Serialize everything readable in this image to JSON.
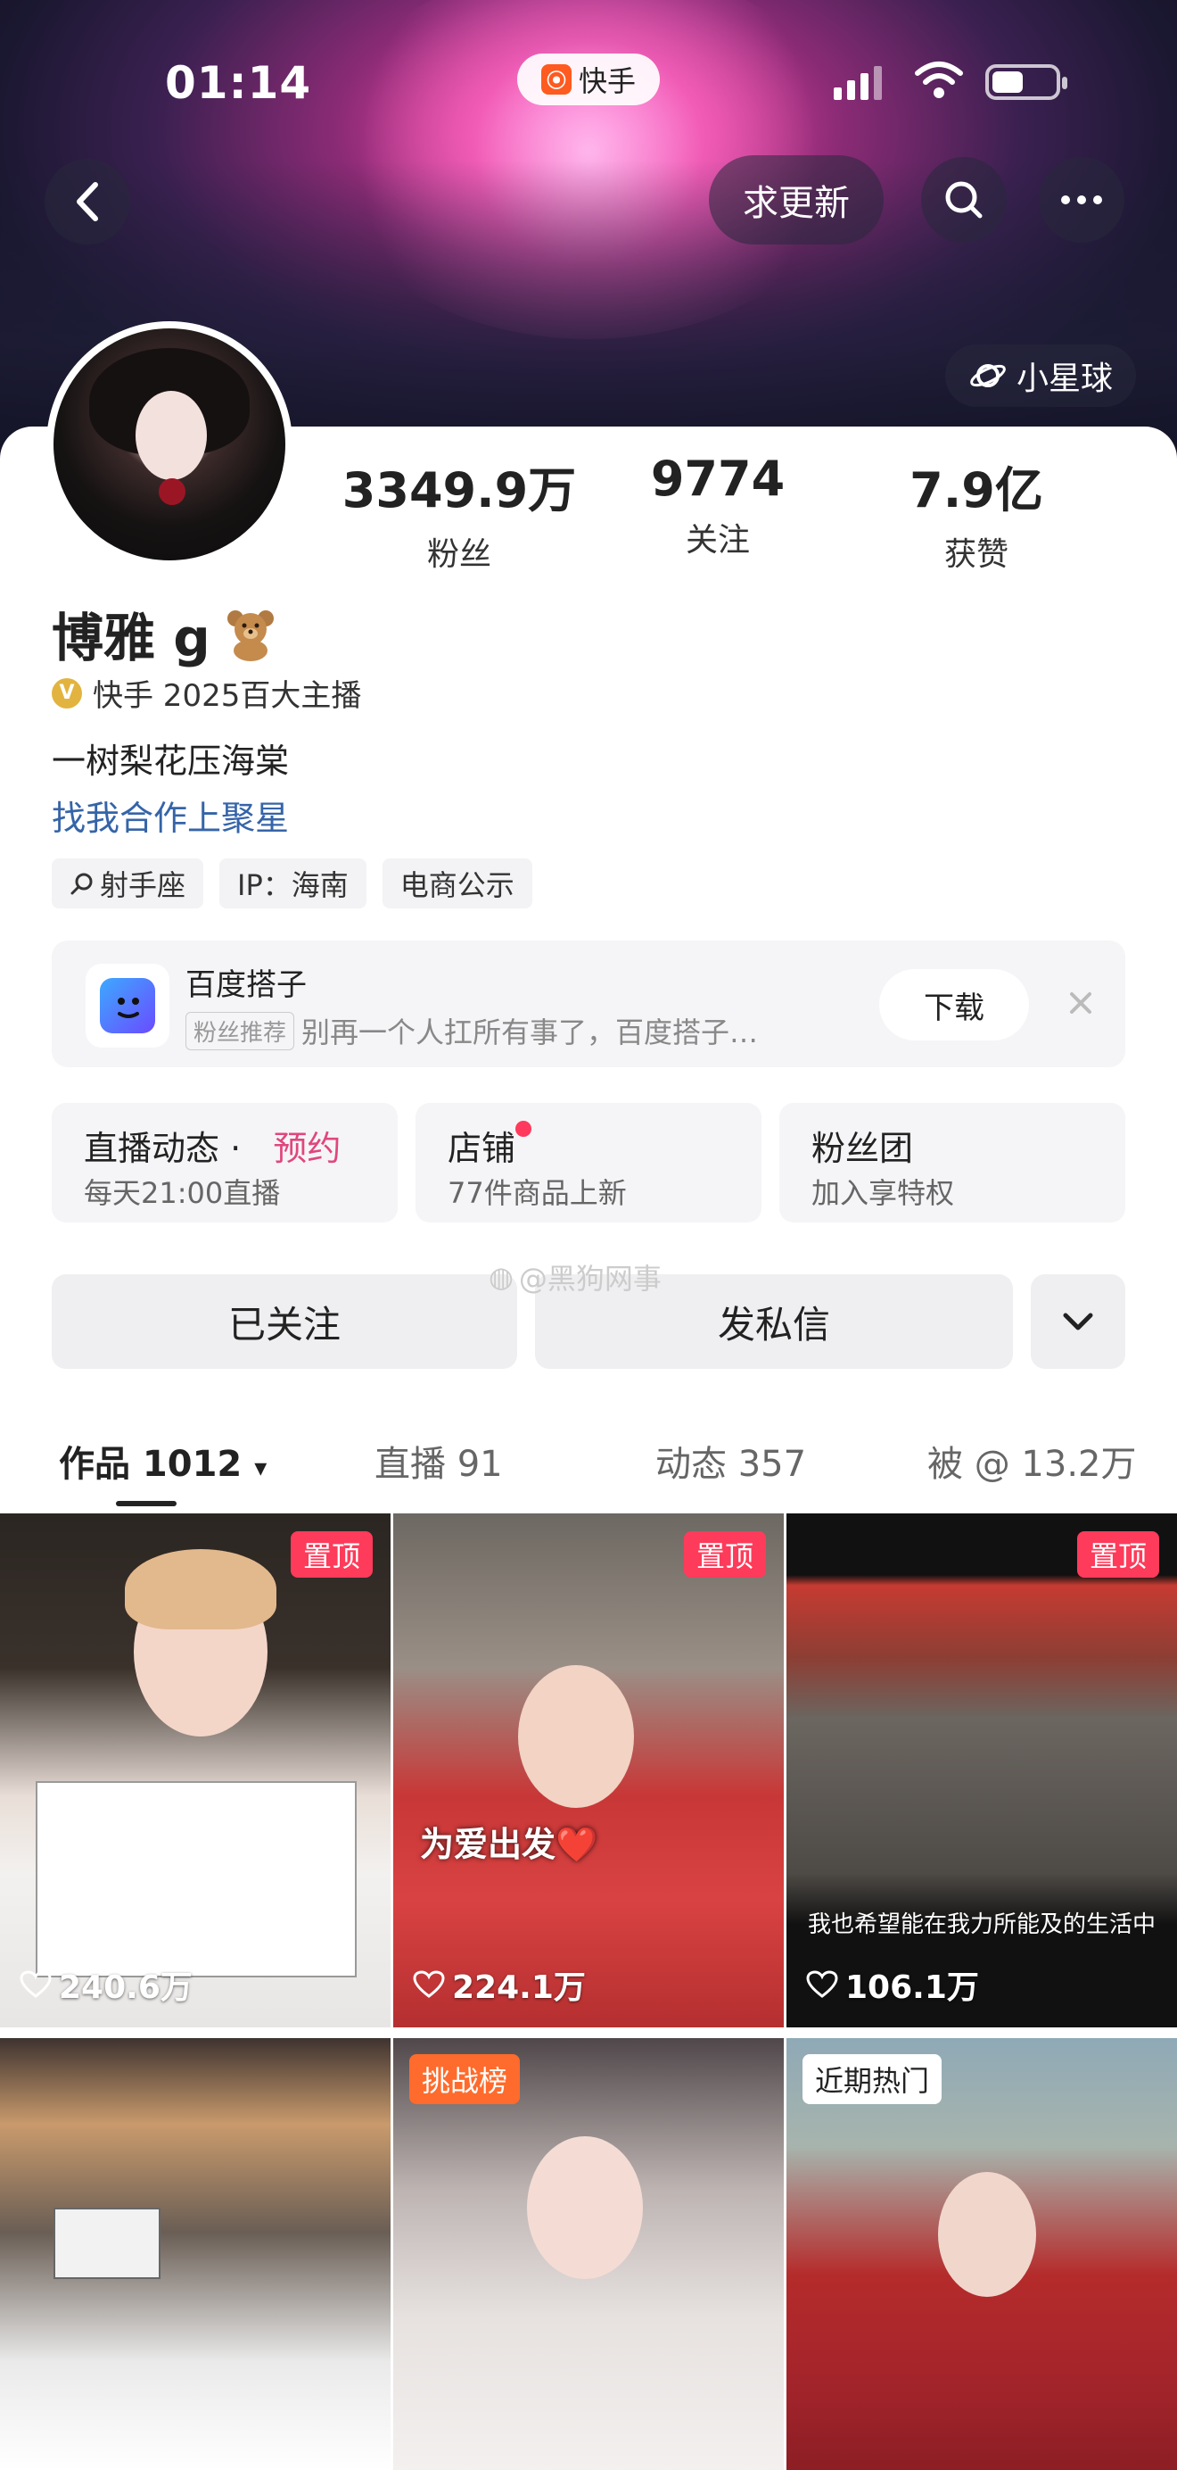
{
  "status_bar": {
    "time": "01:14",
    "app_name": "快手"
  },
  "nav": {
    "update_label": "求更新",
    "planet_label": "小星球"
  },
  "profile": {
    "name": "博雅 g",
    "badge_text": "快手 2025百大主播",
    "bio": "一树梨花压海棠",
    "link_text": "找我合作上聚星",
    "tags": [
      "射手座",
      "IP：海南",
      "电商公示"
    ]
  },
  "stats": [
    {
      "value": "3349.9万",
      "label": "粉丝"
    },
    {
      "value": "9774",
      "label": "关注"
    },
    {
      "value": "7.9亿",
      "label": "获赞"
    }
  ],
  "ad": {
    "title": "百度搭子",
    "tag": "粉丝推荐",
    "desc": "别再一个人扛所有事了，百度搭子…",
    "download_label": "下载"
  },
  "features": [
    {
      "title": "直播动态 ·",
      "highlight": "预约",
      "sub": "每天21:00直播"
    },
    {
      "title": "店铺",
      "sub": "77件商品上新"
    },
    {
      "title": "粉丝团",
      "sub": "加入享特权"
    }
  ],
  "watermark": "@黑狗网事",
  "actions": {
    "follow_label": "已关注",
    "message_label": "发私信"
  },
  "tabs": [
    {
      "label": "作品 1012"
    },
    {
      "label": "直播 91"
    },
    {
      "label": "动态 357"
    },
    {
      "label": "被 @ 13.2万"
    }
  ],
  "videos": [
    {
      "badge": "置顶",
      "likes": "240.6万"
    },
    {
      "badge": "置顶",
      "likes": "224.1万",
      "overlay": "为爱出发❤️"
    },
    {
      "badge": "置顶",
      "likes": "106.1万",
      "caption": "我也希望能在我力所能及的生活中"
    },
    {
      "badge": ""
    },
    {
      "badge": "挑战榜"
    },
    {
      "badge": "近期热门"
    }
  ],
  "colors": {
    "accent_pink": "#fe3b5a",
    "link_blue": "#3564a8",
    "challenge_orange": "#ff6b2c"
  }
}
